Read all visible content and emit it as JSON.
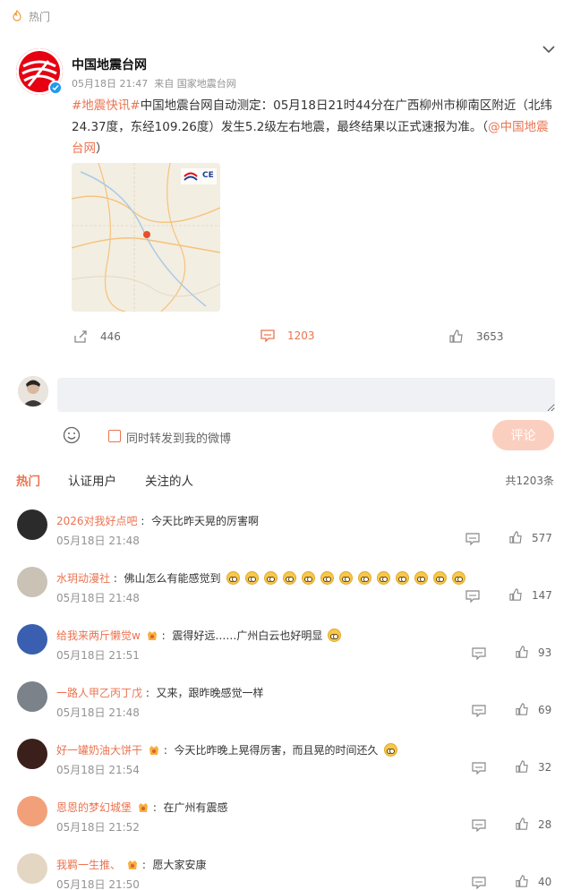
{
  "hot_bar": {
    "label": "热门"
  },
  "post": {
    "author": "中国地震台网",
    "time": "05月18日 21:47",
    "source": "来自 国家地震台网",
    "hashtag": "#地震快讯#",
    "body": "中国地震台网自动测定：05月18日21时44分在广西柳州市柳南区附近（北纬24.37度，东经109.26度）发生5.2级左右地震，最终结果以正式速报为准。（",
    "mention": "@中国地震台网",
    "body_end": "）",
    "map_logo": "CE",
    "reposts": "446",
    "comments": "1203",
    "likes": "3653"
  },
  "composer": {
    "forward_label": "同时转发到我的微博",
    "submit_label": "评论"
  },
  "tabs": {
    "hot": "热门",
    "verified": "认证用户",
    "following": "关注的人",
    "total": "共1203条"
  },
  "comments": [
    {
      "user": "2026对我好点吧",
      "text": "今天比昨天晃的厉害啊",
      "time": "05月18日 21:48",
      "likes": "577",
      "avatar_color": "#2b2b2b",
      "badge": false,
      "emoji_count": 0,
      "suffix_emoji": false
    },
    {
      "user": "水玥动漫社",
      "text": "佛山怎么有能感觉到",
      "time": "05月18日 21:48",
      "likes": "147",
      "avatar_color": "#c9c2b5",
      "badge": false,
      "emoji_count": 13,
      "suffix_emoji": false
    },
    {
      "user": "给我来两斤懒觉w",
      "text": "震得好远……广州白云也好明显",
      "time": "05月18日 21:51",
      "likes": "93",
      "avatar_color": "#3a5fb0",
      "badge": true,
      "emoji_count": 0,
      "suffix_emoji": true
    },
    {
      "user": "一路人甲乙丙丁戊",
      "text": "又来，跟昨晚感觉一样",
      "time": "05月18日 21:48",
      "likes": "69",
      "avatar_color": "#7b8289",
      "badge": false,
      "emoji_count": 0,
      "suffix_emoji": false
    },
    {
      "user": "好一罐奶油大饼干",
      "text": "今天比昨晚上晃得厉害，而且晃的时间还久",
      "time": "05月18日 21:54",
      "likes": "32",
      "avatar_color": "#3b1f1b",
      "badge": true,
      "emoji_count": 0,
      "suffix_emoji": true
    },
    {
      "user": "恩恩的梦幻城堡",
      "text": "在广州有震感",
      "time": "05月18日 21:52",
      "likes": "28",
      "avatar_color": "#f2a07a",
      "badge": true,
      "emoji_count": 0,
      "suffix_emoji": false
    },
    {
      "user": "我羁一生推、",
      "text": "愿大家安康",
      "time": "05月18日 21:50",
      "likes": "40",
      "avatar_color": "#e3d6c3",
      "badge": true,
      "emoji_count": 0,
      "suffix_emoji": false
    }
  ]
}
